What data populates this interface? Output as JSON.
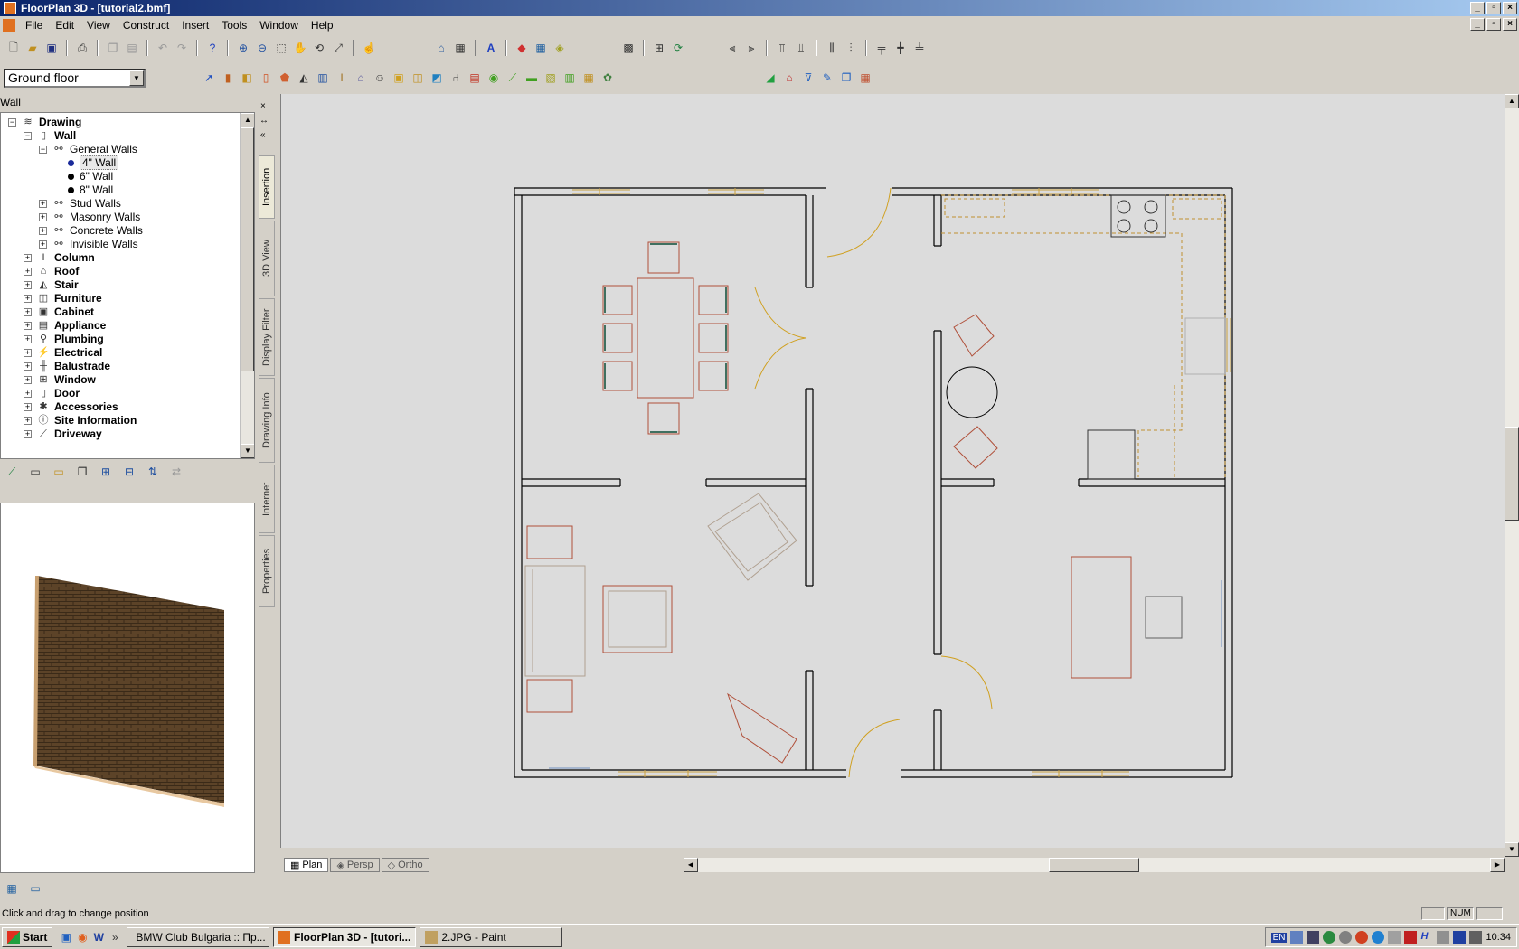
{
  "window": {
    "title": "FloorPlan 3D - [tutorial2.bmf]"
  },
  "menu": [
    "File",
    "Edit",
    "View",
    "Construct",
    "Insert",
    "Tools",
    "Window",
    "Help"
  ],
  "floor_select": {
    "value": "Ground floor"
  },
  "panel": {
    "title": "Wall"
  },
  "tree": [
    {
      "label": "Drawing",
      "level": 0,
      "expander": "−",
      "bold": true,
      "icon": "layers-icon"
    },
    {
      "label": "Wall",
      "level": 1,
      "expander": "−",
      "bold": true,
      "icon": "wall-icon"
    },
    {
      "label": "General Walls",
      "level": 2,
      "expander": "−",
      "bold": false,
      "icon": "group-icon"
    },
    {
      "label": "4\" Wall",
      "level": 3,
      "expander": "",
      "bold": false,
      "icon": "dot",
      "selected": true
    },
    {
      "label": "6\" Wall",
      "level": 3,
      "expander": "",
      "bold": false,
      "icon": "dot"
    },
    {
      "label": "8\" Wall",
      "level": 3,
      "expander": "",
      "bold": false,
      "icon": "dot"
    },
    {
      "label": "Stud Walls",
      "level": 2,
      "expander": "+",
      "bold": false,
      "icon": "group-icon"
    },
    {
      "label": "Masonry Walls",
      "level": 2,
      "expander": "+",
      "bold": false,
      "icon": "group-icon"
    },
    {
      "label": "Concrete Walls",
      "level": 2,
      "expander": "+",
      "bold": false,
      "icon": "group-icon"
    },
    {
      "label": "Invisible Walls",
      "level": 2,
      "expander": "+",
      "bold": false,
      "icon": "group-icon"
    },
    {
      "label": "Column",
      "level": 1,
      "expander": "+",
      "bold": true,
      "icon": "column-icon"
    },
    {
      "label": "Roof",
      "level": 1,
      "expander": "+",
      "bold": true,
      "icon": "roof-icon"
    },
    {
      "label": "Stair",
      "level": 1,
      "expander": "+",
      "bold": true,
      "icon": "stair-icon"
    },
    {
      "label": "Furniture",
      "level": 1,
      "expander": "+",
      "bold": true,
      "icon": "furniture-icon"
    },
    {
      "label": "Cabinet",
      "level": 1,
      "expander": "+",
      "bold": true,
      "icon": "cabinet-icon"
    },
    {
      "label": "Appliance",
      "level": 1,
      "expander": "+",
      "bold": true,
      "icon": "appliance-icon"
    },
    {
      "label": "Plumbing",
      "level": 1,
      "expander": "+",
      "bold": true,
      "icon": "plumbing-icon"
    },
    {
      "label": "Electrical",
      "level": 1,
      "expander": "+",
      "bold": true,
      "icon": "electrical-icon"
    },
    {
      "label": "Balustrade",
      "level": 1,
      "expander": "+",
      "bold": true,
      "icon": "balustrade-icon"
    },
    {
      "label": "Window",
      "level": 1,
      "expander": "+",
      "bold": true,
      "icon": "window-icon"
    },
    {
      "label": "Door",
      "level": 1,
      "expander": "+",
      "bold": true,
      "icon": "door-icon"
    },
    {
      "label": "Accessories",
      "level": 1,
      "expander": "+",
      "bold": true,
      "icon": "accessories-icon"
    },
    {
      "label": "Site Information",
      "level": 1,
      "expander": "+",
      "bold": true,
      "icon": "site-icon"
    },
    {
      "label": "Driveway",
      "level": 1,
      "expander": "+",
      "bold": true,
      "icon": "driveway-icon"
    }
  ],
  "vertical_tabs": [
    "Insertion",
    "3D View",
    "Display Filter",
    "Drawing Info",
    "Internet",
    "Properties"
  ],
  "view_tabs": [
    "Plan",
    "Persp",
    "Ortho"
  ],
  "status": {
    "text": "Click and drag to change position",
    "num": "NUM"
  },
  "taskbar": {
    "start": "Start",
    "tasks": [
      "BMW Club Bulgaria :: Пр...",
      "FloorPlan 3D - [tutori...",
      "2.JPG - Paint"
    ],
    "clock": "10:34",
    "lang": "EN"
  },
  "colors": {
    "wall": "#000000",
    "furniture": "#b0503a",
    "door": "#d0a020",
    "window": "#c8a040",
    "cabinet": "#c09030"
  }
}
